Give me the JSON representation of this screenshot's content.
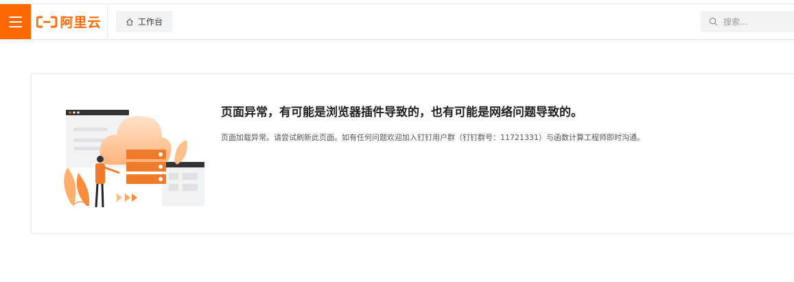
{
  "header": {
    "logo_text": "阿里云",
    "workbench_label": "工作台",
    "search_placeholder": "搜索..."
  },
  "error": {
    "title": "页面异常，有可能是浏览器插件导致的，也有可能是网络问题导致的。",
    "description": "页面加载异常。请尝试刷新此页面。如有任何问题欢迎加入钉钉用户群（钉钉群号：11721331）与函数计算工程师即时沟通。"
  },
  "colors": {
    "brand": "#ff6a00",
    "border": "#e3e5e8"
  }
}
